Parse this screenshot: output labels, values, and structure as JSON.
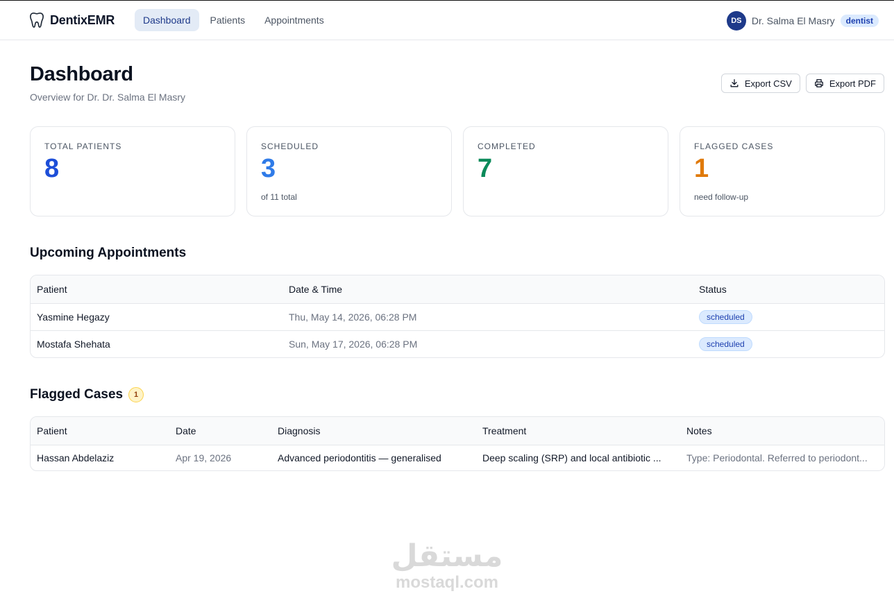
{
  "brand": {
    "name": "DentixEMR"
  },
  "nav": [
    {
      "label": "Dashboard",
      "active": true
    },
    {
      "label": "Patients",
      "active": false
    },
    {
      "label": "Appointments",
      "active": false
    }
  ],
  "user": {
    "initials": "DS",
    "name": "Dr. Salma El Masry",
    "role": "dentist"
  },
  "header": {
    "title": "Dashboard",
    "subtitle": "Overview for Dr. Dr. Salma El Masry",
    "export_csv": "Export CSV",
    "export_pdf": "Export PDF"
  },
  "stats": [
    {
      "label": "TOTAL PATIENTS",
      "value": "8",
      "sub": "",
      "color": "#1d4ed8"
    },
    {
      "label": "SCHEDULED",
      "value": "3",
      "sub": "of 11 total",
      "color": "#2f7be8"
    },
    {
      "label": "COMPLETED",
      "value": "7",
      "sub": "",
      "color": "#0b8a5a"
    },
    {
      "label": "FLAGGED CASES",
      "value": "1",
      "sub": "need follow-up",
      "color": "#e07a0b"
    }
  ],
  "upcoming": {
    "title": "Upcoming Appointments",
    "columns": [
      "Patient",
      "Date & Time",
      "Status"
    ],
    "rows": [
      {
        "patient": "Yasmine Hegazy",
        "datetime": "Thu, May 14, 2026, 06:28 PM",
        "status": "scheduled"
      },
      {
        "patient": "Mostafa Shehata",
        "datetime": "Sun, May 17, 2026, 06:28 PM",
        "status": "scheduled"
      }
    ]
  },
  "flagged": {
    "title": "Flagged Cases",
    "count": "1",
    "columns": [
      "Patient",
      "Date",
      "Diagnosis",
      "Treatment",
      "Notes"
    ],
    "rows": [
      {
        "patient": "Hassan Abdelaziz",
        "date": "Apr 19, 2026",
        "diagnosis": "Advanced periodontitis — generalised",
        "treatment": "Deep scaling (SRP) and local antibiotic ...",
        "notes": "Type: Periodontal. Referred to periodont..."
      }
    ]
  },
  "watermark": {
    "logo": "مستقل",
    "text": "mostaql.com"
  }
}
